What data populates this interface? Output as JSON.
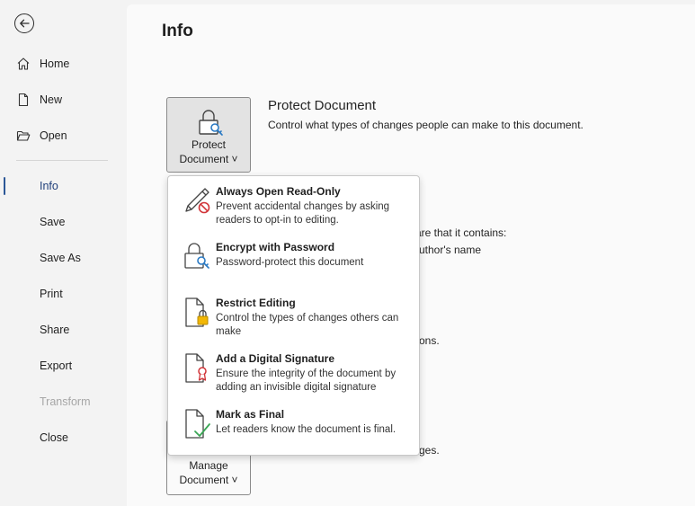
{
  "sidebar": {
    "back_icon": "back-arrow-icon",
    "items": [
      {
        "label": "Home",
        "icon": "home-icon"
      },
      {
        "label": "New",
        "icon": "new-document-icon"
      },
      {
        "label": "Open",
        "icon": "folder-open-icon"
      },
      {
        "label": "Info"
      },
      {
        "label": "Save"
      },
      {
        "label": "Save As"
      },
      {
        "label": "Print"
      },
      {
        "label": "Share"
      },
      {
        "label": "Export"
      },
      {
        "label": "Transform"
      },
      {
        "label": "Close"
      }
    ],
    "active": "Info",
    "disabled": "Transform",
    "accent_color": "#2b5797"
  },
  "main": {
    "title": "Info",
    "protect": {
      "button_line1": "Protect",
      "button_line2": "Document ˅",
      "section_title": "Protect Document",
      "section_desc": "Control what types of changes people can make to this document."
    },
    "background": {
      "inspect_fragment1": "are that it contains:",
      "inspect_fragment2": "uthor's name",
      "versions_fragment": "ons.",
      "manage_fragment": "ges."
    },
    "manage": {
      "button_line1": "Manage",
      "button_line2": "Document ˅"
    }
  },
  "menu": {
    "items": [
      {
        "title": "Always Open Read-Only",
        "desc": "Prevent accidental changes by asking readers to opt-in to editing.",
        "icon": "pencil-no-icon"
      },
      {
        "title": "Encrypt with Password",
        "desc": "Password-protect this document",
        "icon": "lock-key-icon"
      },
      {
        "title": "Restrict Editing",
        "desc": "Control the types of changes others can make",
        "icon": "document-lock-icon"
      },
      {
        "title": "Add a Digital Signature",
        "desc": "Ensure the integrity of the document by adding an invisible digital signature",
        "icon": "document-ribbon-icon"
      },
      {
        "title": "Mark as Final",
        "desc": "Let readers know the document is final.",
        "icon": "document-check-icon"
      }
    ]
  }
}
